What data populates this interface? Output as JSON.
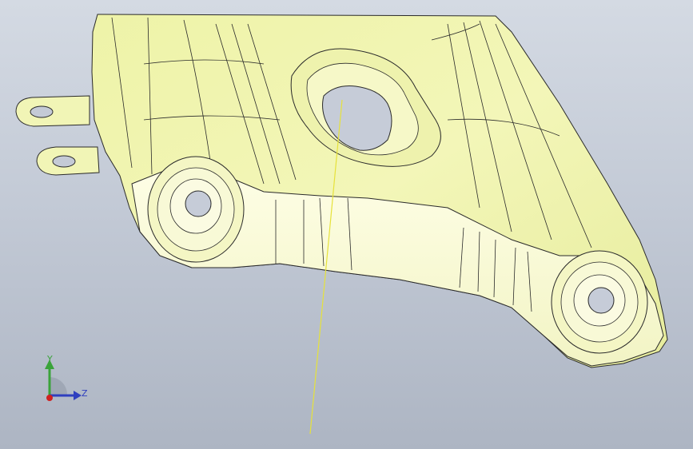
{
  "viewport": {
    "background_top": "#d4dae3",
    "background_bottom": "#adb5c3"
  },
  "part": {
    "face_color": "#f4f7c0",
    "highlight_color": "#fefedf",
    "edge_color": "#2a2a2a",
    "axis_line_color": "#e6e23a"
  },
  "triad": {
    "y_label": "Y",
    "z_label": "Z",
    "y_color": "#3aa33a",
    "z_color": "#2f3fbf",
    "x_color": "#d02020"
  }
}
